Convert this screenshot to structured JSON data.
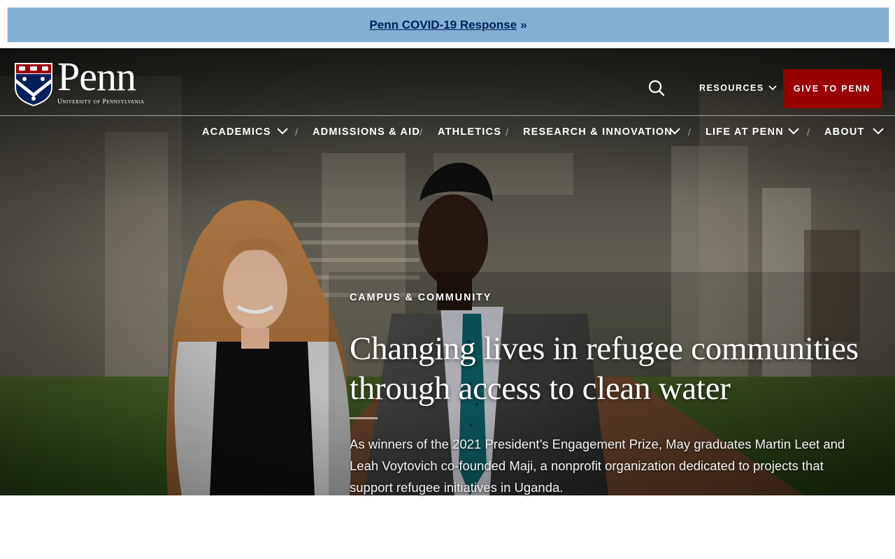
{
  "alert": {
    "link_label": "Penn COVID-19 Response",
    "suffix": "»"
  },
  "header": {
    "logo_wordmark": "Penn",
    "logo_subtitle": "University of Pennsylvania",
    "resources_label": "RESOURCES",
    "give_label": "GIVE TO PENN"
  },
  "nav": {
    "items": [
      {
        "label": "ACADEMICS",
        "has_dropdown": true
      },
      {
        "label": "ADMISSIONS & AID",
        "has_dropdown": false
      },
      {
        "label": "ATHLETICS",
        "has_dropdown": false
      },
      {
        "label": "RESEARCH & INNOVATION",
        "has_dropdown": true
      },
      {
        "label": "LIFE AT PENN",
        "has_dropdown": true
      },
      {
        "label": "ABOUT",
        "has_dropdown": true
      }
    ],
    "separator": "/"
  },
  "hero": {
    "eyebrow": "CAMPUS & COMMUNITY",
    "headline_line1": "Changing lives in refugee communities",
    "headline_line2": "through access to clean water",
    "summary": "As winners of the 2021 President’s Engagement Prize, May graduates Martin Leet and Leah Voytovich co-founded Maji, a nonprofit organization dedicated to projects that support refugee initiatives in Uganda."
  },
  "colors": {
    "alert_bg": "#82afd3",
    "alert_text": "#011f5b",
    "give_bg": "#990000",
    "penn_blue": "#011f5b",
    "penn_red": "#990000"
  }
}
